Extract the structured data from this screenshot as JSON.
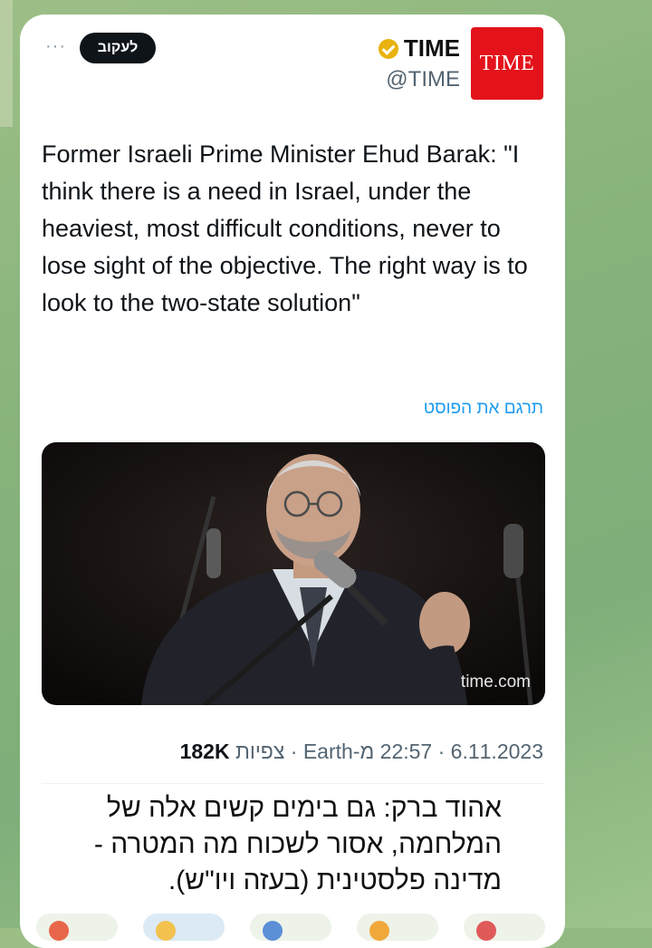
{
  "tweet": {
    "account": {
      "logo_text": "TIME",
      "name": "TIME",
      "handle": "@TIME",
      "verified_color": "#e9b20c",
      "brand_color": "#e3121b"
    },
    "follow_label": "לעקוב",
    "more_icon": "more-dots-icon",
    "text": "Former Israeli Prime Minister Ehud Barak: \"I think there is a need in Israel, under the heaviest, most difficult conditions, never to lose sight of the objective. The right way is to look to the two-state solution\"",
    "translate_label": "תרגם את הפוסט",
    "media": {
      "watermark": "time.com"
    },
    "meta": {
      "date": "6.11.2023",
      "time_source": "22:57 מ-Earth",
      "views_count": "182K",
      "views_label": "צפיות"
    }
  },
  "caption": "אהוד ברק: גם בימים קשים אלה של המלחמה, אסור לשכוח מה המטרה - מדינה פלסטינית (בעזה ויו\"ש)."
}
